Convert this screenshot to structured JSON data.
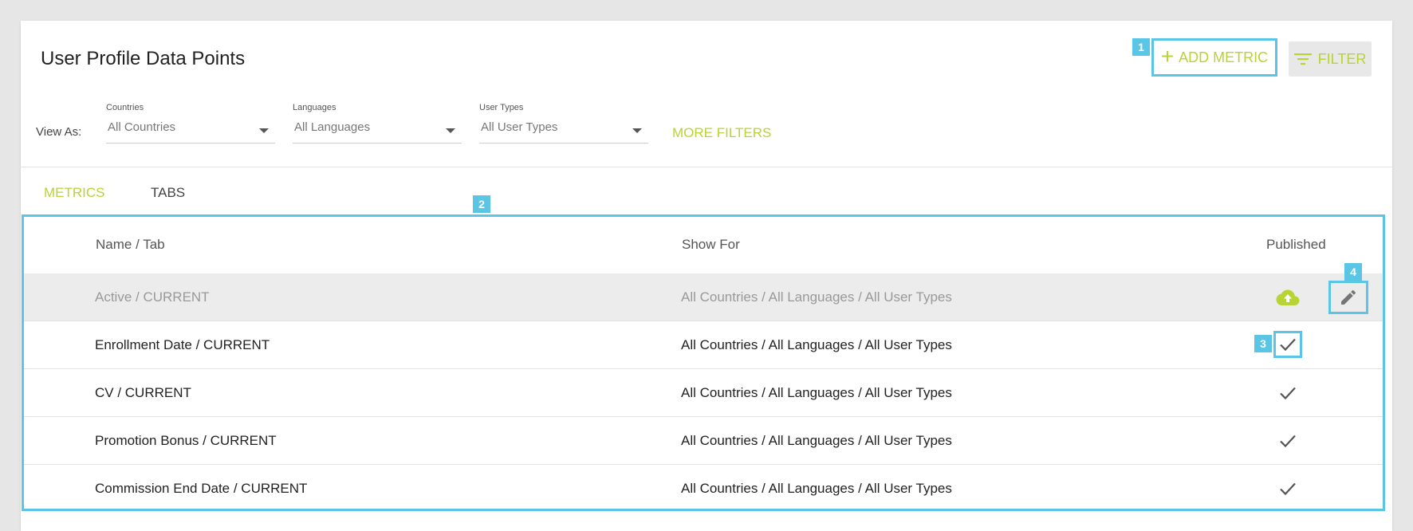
{
  "header": {
    "title": "User Profile Data Points",
    "add_metric_label": "ADD METRIC",
    "filter_label": "FILTER"
  },
  "annotations": {
    "add_metric": "1",
    "table": "2",
    "published_check": "3",
    "edit": "4"
  },
  "filters": {
    "view_as_label": "View As:",
    "countries": {
      "label": "Countries",
      "value": "All Countries"
    },
    "languages": {
      "label": "Languages",
      "value": "All Languages"
    },
    "user_types": {
      "label": "User Types",
      "value": "All User Types"
    },
    "more_filters_label": "MORE FILTERS"
  },
  "tabs": [
    {
      "label": "METRICS",
      "active": true
    },
    {
      "label": "TABS",
      "active": false
    }
  ],
  "table": {
    "headers": {
      "name": "Name / Tab",
      "show_for": "Show For",
      "published": "Published"
    },
    "rows": [
      {
        "name": "Active / CURRENT",
        "show_for": "All Countries / All Languages / All User Types",
        "published_icon": "cloud-upload-icon"
      },
      {
        "name": "Enrollment Date / CURRENT",
        "show_for": "All Countries / All Languages / All User Types",
        "published_icon": "check-icon"
      },
      {
        "name": "CV / CURRENT",
        "show_for": "All Countries / All Languages / All User Types",
        "published_icon": "check-icon"
      },
      {
        "name": "Promotion Bonus / CURRENT",
        "show_for": "All Countries / All Languages / All User Types",
        "published_icon": "check-icon"
      },
      {
        "name": "Commission End Date / CURRENT",
        "show_for": "All Countries / All Languages / All User Types",
        "published_icon": "check-icon"
      }
    ]
  },
  "colors": {
    "accent": "#b8d334",
    "annotation": "#5bc5e6",
    "background": "#e6e6e6",
    "highlight_row": "#ececec"
  }
}
